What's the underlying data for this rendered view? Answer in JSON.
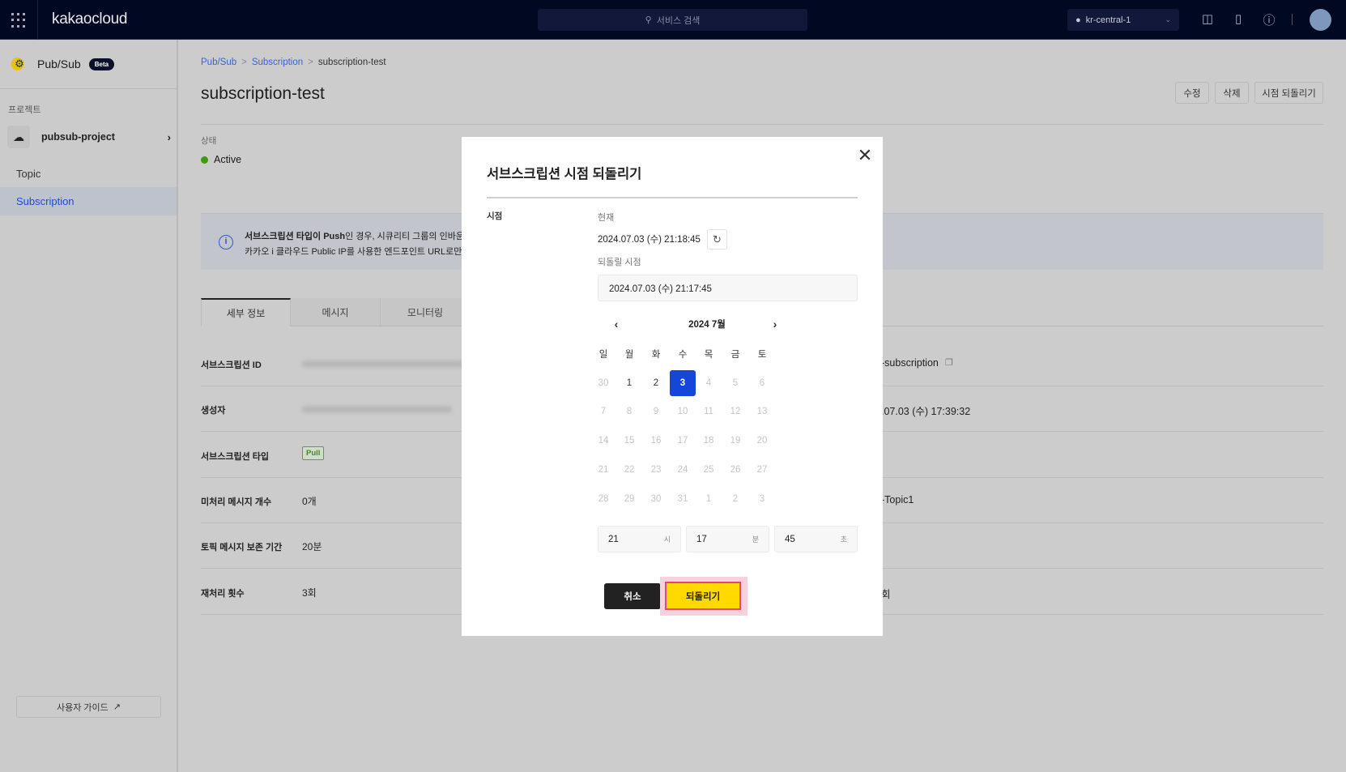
{
  "header": {
    "logo": "kakaocloud",
    "search_placeholder": "서비스 검색",
    "region": "kr-central-1"
  },
  "sidebar": {
    "service": "Pub/Sub",
    "badge": "Beta",
    "section_label": "프로젝트",
    "project": "pubsub-project",
    "items": [
      {
        "label": "Topic"
      },
      {
        "label": "Subscription",
        "selected": true
      }
    ],
    "guide": "사용자 가이드"
  },
  "breadcrumb": [
    "Pub/Sub",
    "Subscription",
    "subscription-test"
  ],
  "page": {
    "title": "subscription-test",
    "buttons": [
      "수정",
      "삭제",
      "시점 되돌리기"
    ],
    "status_label": "상태",
    "status": "Active",
    "status_color": "#3d9b0f"
  },
  "info": {
    "bold": "서브스크립션 타입이 Push",
    "line1": "인 경우, 시큐리티 그룹의 인바운드 ",
    "line2": "카카오 i 클라우드 Public IP를 사용한 엔드포인트 URL로만 Pus"
  },
  "tabs": [
    {
      "label": "세부 정보",
      "selected": true
    },
    {
      "label": "메시지"
    },
    {
      "label": "모니터링"
    }
  ],
  "details": [
    {
      "label": "서브스크립션 ID",
      "value": "",
      "right": "-subscription"
    },
    {
      "label": "생성자",
      "value": "",
      "right": ".07.03 (수) 17:39:32"
    },
    {
      "label": "서브스크립션 타입",
      "value": "Pull",
      "right": ""
    },
    {
      "label": "미처리 메시지 개수",
      "value": "0개",
      "right": "-Topic1"
    },
    {
      "label": "토픽 메시지 보존 기간",
      "value": "20분",
      "right": ""
    },
    {
      "label": "재처리 횟수",
      "value": "3회",
      "right": "회"
    }
  ],
  "modal": {
    "title": "서브스크립션 시점 되돌리기",
    "field_label": "시점",
    "current_label": "현재",
    "current_time": "2024.07.03 (수) 21:18:45",
    "target_label": "되돌릴 시점",
    "target_time": "2024.07.03 (수) 21:17:45",
    "calendar": {
      "month": "2024  7월",
      "weekdays": [
        "일",
        "월",
        "화",
        "수",
        "목",
        "금",
        "토"
      ],
      "weeks": [
        [
          "30",
          "1",
          "2",
          "3",
          "4",
          "5",
          "6"
        ],
        [
          "7",
          "8",
          "9",
          "10",
          "11",
          "12",
          "13"
        ],
        [
          "14",
          "15",
          "16",
          "17",
          "18",
          "19",
          "20"
        ],
        [
          "21",
          "22",
          "23",
          "24",
          "25",
          "26",
          "27"
        ],
        [
          "28",
          "29",
          "30",
          "31",
          "1",
          "2",
          "3"
        ]
      ],
      "selected": "3"
    },
    "hour": "21",
    "hour_unit": "시",
    "minute": "17",
    "minute_unit": "분",
    "second": "45",
    "second_unit": "초",
    "cancel": "취소",
    "confirm": "되돌리기",
    "accent": "#1646d8",
    "confirm_color": "#ffd900"
  }
}
